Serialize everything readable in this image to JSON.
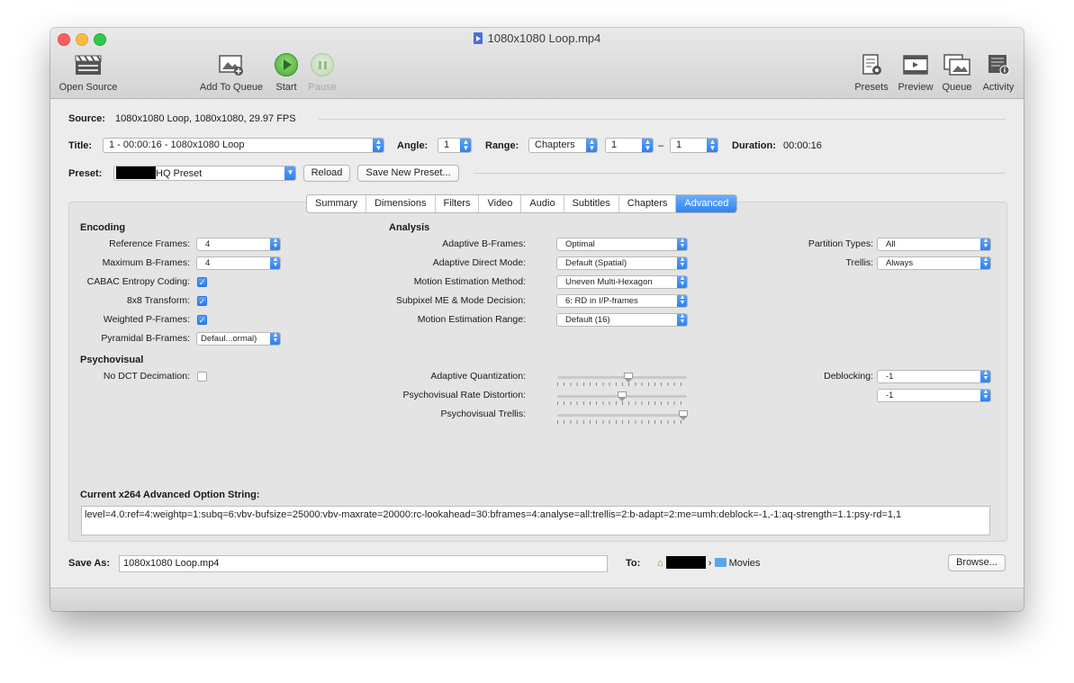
{
  "window": {
    "title": "1080x1080 Loop.mp4"
  },
  "toolbar": {
    "open_source": "Open Source",
    "add_to_queue": "Add To Queue",
    "start": "Start",
    "pause": "Pause",
    "presets": "Presets",
    "preview": "Preview",
    "queue": "Queue",
    "activity": "Activity"
  },
  "source": {
    "label": "Source:",
    "value": "1080x1080 Loop, 1080x1080, 29.97 FPS"
  },
  "title_row": {
    "title_label": "Title:",
    "title_value": "1 - 00:00:16 - 1080x1080 Loop",
    "angle_label": "Angle:",
    "angle_value": "1",
    "range_label": "Range:",
    "range_type": "Chapters",
    "range_start": "1",
    "range_dash": "–",
    "range_end": "1",
    "duration_label": "Duration:",
    "duration_value": "00:00:16"
  },
  "preset": {
    "label": "Preset:",
    "value": "HQ Preset",
    "reload": "Reload",
    "save_new": "Save New Preset..."
  },
  "tabs": [
    "Summary",
    "Dimensions",
    "Filters",
    "Video",
    "Audio",
    "Subtitles",
    "Chapters",
    "Advanced"
  ],
  "active_tab": "Advanced",
  "encoding": {
    "title": "Encoding",
    "reference_frames_label": "Reference Frames:",
    "reference_frames": "4",
    "max_bframes_label": "Maximum B-Frames:",
    "max_bframes": "4",
    "cabac_label": "CABAC Entropy Coding:",
    "cabac": true,
    "transform_label": "8x8 Transform:",
    "transform": true,
    "weighted_p_label": "Weighted P-Frames:",
    "weighted_p": true,
    "pyramidal_label": "Pyramidal B-Frames:",
    "pyramidal": "Defaul...ormal)"
  },
  "analysis": {
    "title": "Analysis",
    "adaptive_bframes_label": "Adaptive B-Frames:",
    "adaptive_bframes": "Optimal",
    "adaptive_direct_label": "Adaptive Direct Mode:",
    "adaptive_direct": "Default (Spatial)",
    "me_method_label": "Motion Estimation Method:",
    "me_method": "Uneven Multi-Hexagon",
    "subpixel_label": "Subpixel ME & Mode Decision:",
    "subpixel": "6: RD in I/P-frames",
    "me_range_label": "Motion Estimation Range:",
    "me_range": "Default (16)",
    "partition_label": "Partition Types:",
    "partition": "All",
    "trellis_label": "Trellis:",
    "trellis": "Always"
  },
  "psychovisual": {
    "title": "Psychovisual",
    "no_dct_label": "No DCT Decimation:",
    "no_dct": false,
    "aq_label": "Adaptive Quantization:",
    "aq_level": 0.55,
    "psy_rd_label": "Psychovisual Rate Distortion:",
    "psy_rd_level": 0.5,
    "psy_trellis_label": "Psychovisual Trellis:",
    "psy_trellis_level": 0.97,
    "deblocking_label": "Deblocking:",
    "deblock_1": "-1",
    "deblock_2": "-1"
  },
  "option_string": {
    "label": "Current x264 Advanced Option String:",
    "value": "level=4.0:ref=4:weightp=1:subq=6:vbv-bufsize=25000:vbv-maxrate=20000:rc-lookahead=30:bframes=4:analyse=all:trellis=2:b-adapt=2:me=umh:deblock=-1,-1:aq-strength=1.1:psy-rd=1,1"
  },
  "save": {
    "label": "Save As:",
    "filename": "1080x1080 Loop.mp4",
    "to_label": "To:",
    "path_separator": "›",
    "folder": "Movies",
    "browse": "Browse..."
  }
}
